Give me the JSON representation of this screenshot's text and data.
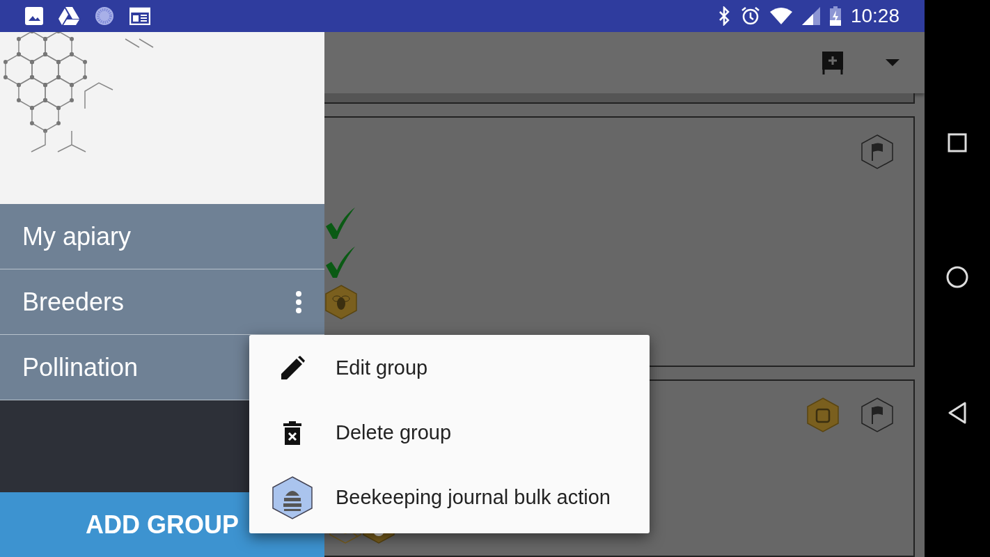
{
  "status_bar": {
    "time": "10:28"
  },
  "drawer": {
    "groups": [
      {
        "label": "My apiary",
        "has_menu": false
      },
      {
        "label": "Breeders",
        "has_menu": true
      },
      {
        "label": "Pollination",
        "has_menu": false
      }
    ],
    "add_button": "ADD GROUP"
  },
  "popup_menu": {
    "items": [
      {
        "kind": "edit",
        "label": "Edit group"
      },
      {
        "kind": "delete",
        "label": "Delete group"
      },
      {
        "kind": "journal",
        "label": "Beekeeping journal bulk action"
      }
    ]
  }
}
